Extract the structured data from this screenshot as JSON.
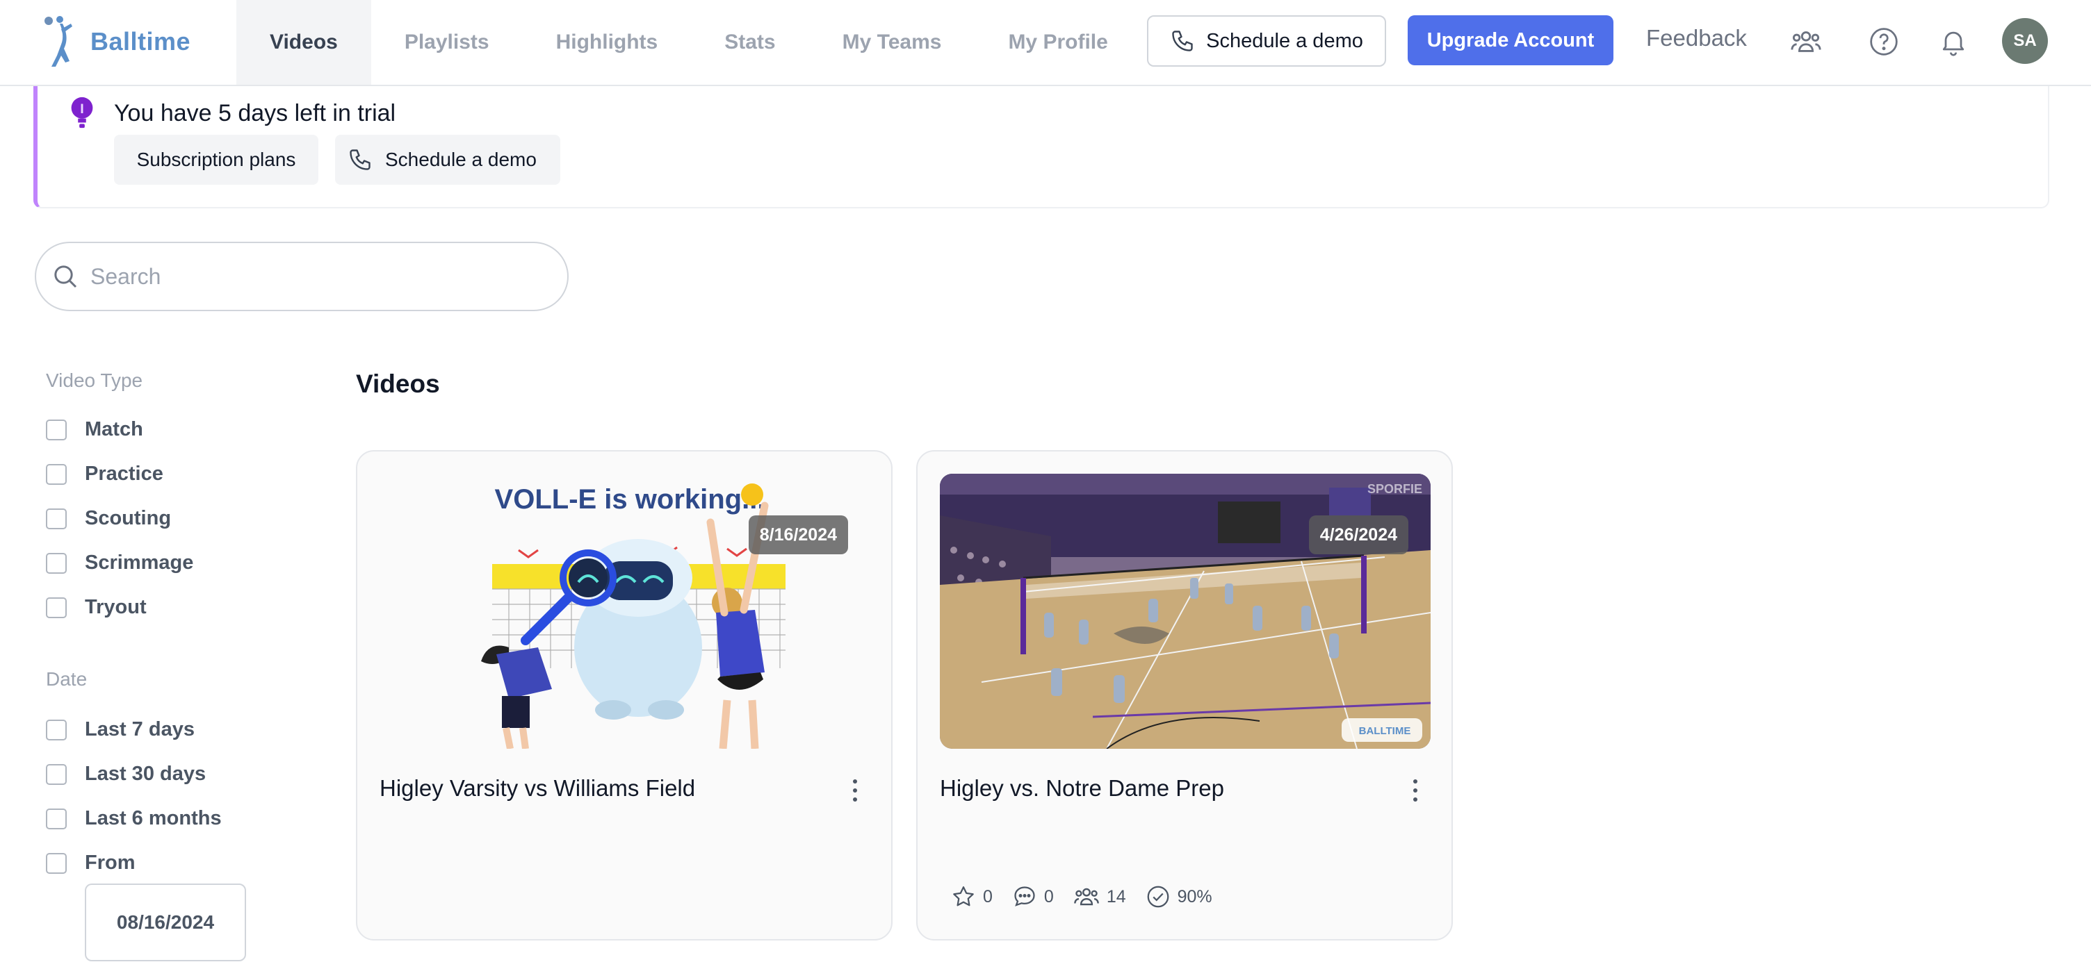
{
  "brand": {
    "name": "Balltime"
  },
  "nav": {
    "tabs": [
      {
        "label": "Videos",
        "active": true
      },
      {
        "label": "Playlists"
      },
      {
        "label": "Highlights"
      },
      {
        "label": "Stats"
      },
      {
        "label": "My Teams"
      },
      {
        "label": "My Profile"
      }
    ],
    "schedule_demo": "Schedule a demo",
    "upgrade": "Upgrade Account",
    "feedback": "Feedback",
    "avatar_initials": "SA",
    "icons": [
      "team-icon",
      "help-icon",
      "bell-icon"
    ]
  },
  "banner": {
    "message": "You have 5 days left in trial",
    "plans_button": "Subscription plans",
    "demo_button": "Schedule a demo",
    "accent": "#c084fc"
  },
  "search": {
    "placeholder": "Search",
    "value": ""
  },
  "filters": {
    "video_type": {
      "heading": "Video Type",
      "options": [
        "Match",
        "Practice",
        "Scouting",
        "Scrimmage",
        "Tryout"
      ]
    },
    "date": {
      "heading": "Date",
      "options": [
        "Last 7 days",
        "Last 30 days",
        "Last 6 months",
        "From"
      ],
      "from_value": "08/16/2024"
    }
  },
  "videos": {
    "title": "Videos",
    "items": [
      {
        "title": "Higley Varsity vs Williams Field",
        "date": "8/16/2024",
        "thumbnail_caption": "VOLL-E is working..."
      },
      {
        "title": "Higley vs. Notre Dame Prep",
        "date": "4/26/2024",
        "watermark_top": "SPORFIE",
        "watermark_bottom": "BALLTIME",
        "stats": {
          "stars": "0",
          "comments": "0",
          "players": "14",
          "progress": "90%"
        }
      }
    ]
  },
  "colors": {
    "primary": "#4f6fea",
    "brand": "#5b8fc9",
    "muted": "#9ca3af"
  }
}
